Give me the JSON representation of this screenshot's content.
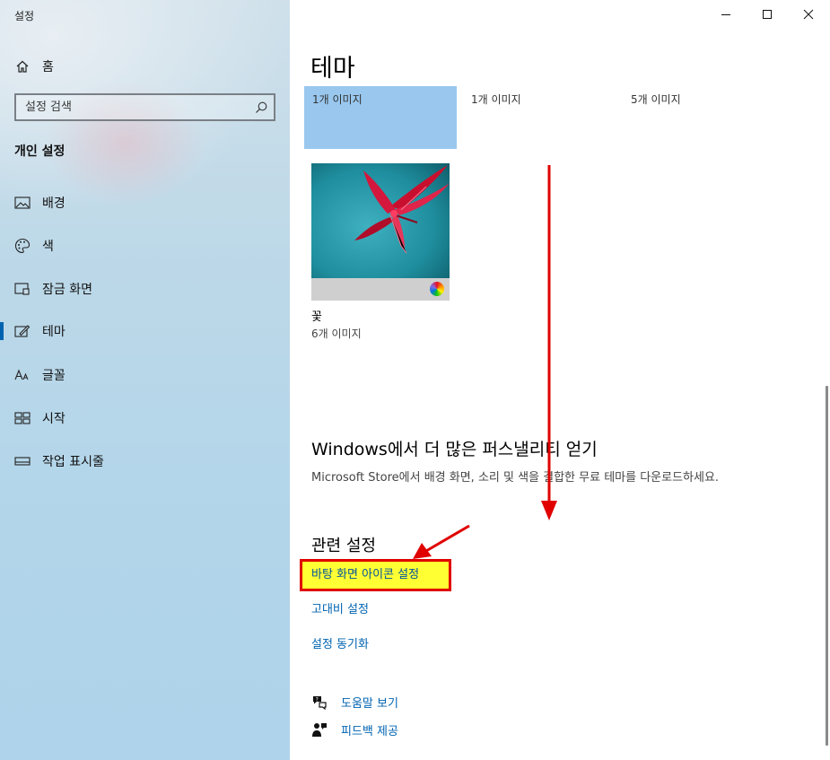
{
  "window": {
    "title": "설정"
  },
  "sidebar": {
    "home_label": "홈",
    "search_placeholder": "설정 검색",
    "section_title": "개인 설정",
    "items": [
      {
        "label": "배경",
        "icon": "image-icon"
      },
      {
        "label": "색",
        "icon": "palette-icon"
      },
      {
        "label": "잠금 화면",
        "icon": "lock-screen-icon"
      },
      {
        "label": "테마",
        "icon": "theme-brush-icon",
        "active": true
      },
      {
        "label": "글꼴",
        "icon": "font-icon"
      },
      {
        "label": "시작",
        "icon": "start-icon"
      },
      {
        "label": "작업 표시줄",
        "icon": "taskbar-icon"
      }
    ]
  },
  "main": {
    "title": "테마",
    "theme_tiles": [
      {
        "count": "1개 이미지"
      },
      {
        "count": "1개 이미지"
      },
      {
        "count": "5개 이미지"
      }
    ],
    "flower_theme": {
      "name": "꽃",
      "count": "6개 이미지"
    },
    "more": {
      "heading": "Windows에서 더 많은 퍼스낼리티 얻기",
      "description": "Microsoft Store에서 배경 화면, 소리 및 색을 결합한 무료 테마를 다운로드하세요."
    },
    "related": {
      "heading": "관련 설정",
      "links": [
        "바탕 화면 아이콘 설정",
        "고대비 설정",
        "설정 동기화"
      ]
    },
    "help": {
      "help_label": "도움말 보기",
      "feedback_label": "피드백 제공"
    }
  },
  "colors": {
    "accent": "#0063b1",
    "selected_tile": "#99c7ee",
    "annotation_red": "#e00000",
    "highlight_yellow": "#ffff33"
  }
}
